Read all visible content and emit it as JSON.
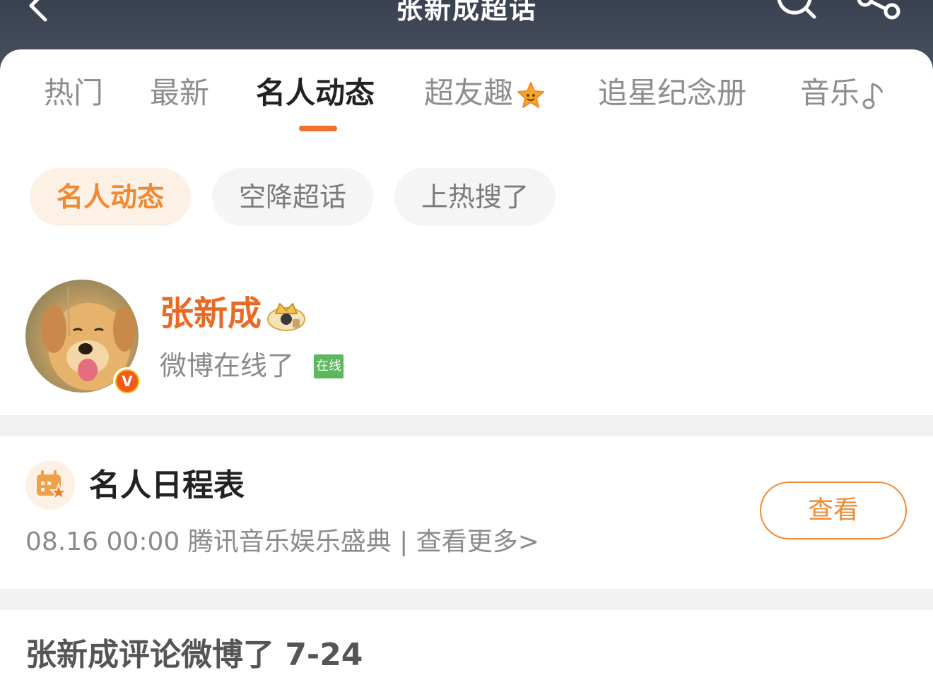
{
  "header": {
    "title": "张新成超话",
    "back_icon": "chevron-left-icon",
    "search_icon": "search-icon",
    "share_icon": "share-icon"
  },
  "tabs": [
    {
      "label": "热门",
      "active": false
    },
    {
      "label": "最新",
      "active": false
    },
    {
      "label": "名人动态",
      "active": true
    },
    {
      "label": "超友趣",
      "active": false,
      "icon": "star-emblem-icon"
    },
    {
      "label": "追星纪念册",
      "active": false
    },
    {
      "label": "音乐",
      "active": false,
      "icon": "music-note-icon"
    }
  ],
  "chips": [
    {
      "label": "名人动态",
      "active": true
    },
    {
      "label": "空降超话",
      "active": false
    },
    {
      "label": "上热搜了",
      "active": false
    }
  ],
  "celebrity": {
    "name": "张新成",
    "online_badge": "在线",
    "status": "微博在线了",
    "verified_icon": "verified-v-icon",
    "crown_icon": "crown-icon"
  },
  "schedule": {
    "title": "名人日程表",
    "item": "08.16 00:00 腾讯音乐娱乐盛典 |",
    "more": "查看更多>",
    "button": "查看",
    "icon": "calendar-star-icon"
  },
  "feed": {
    "title": "张新成评论微博了 7-24"
  },
  "colors": {
    "accent": "#ef8a34",
    "accent_dark": "#e86b25",
    "header_bg": "#3a4150",
    "online_green": "#5cb85c"
  }
}
